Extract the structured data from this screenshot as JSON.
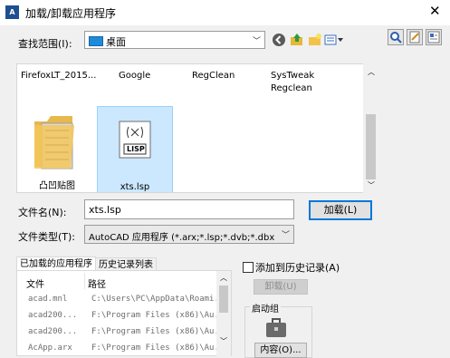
{
  "window": {
    "title": "加载/卸载应用程序",
    "close_glyph": "✕",
    "icon_text": "A"
  },
  "lookin": {
    "label": "查找范围(I):",
    "value": "桌面"
  },
  "files_row1": [
    {
      "name": "FirefoxLT_2015..."
    },
    {
      "name": "Google"
    },
    {
      "name": "RegClean"
    },
    {
      "name": "SysTweak Regclean"
    }
  ],
  "files_row2": [
    {
      "name": "凸凹贴图",
      "icon": "folder-icon"
    },
    {
      "name": "xts.lsp",
      "icon": "lisp-file-icon",
      "badge": "LISP"
    }
  ],
  "filename": {
    "label": "文件名(N):",
    "value": "xts.lsp"
  },
  "filetype": {
    "label": "文件类型(T):",
    "value": "AutoCAD 应用程序 (*.arx;*.lsp;*.dvb;*.dbx;*.vl> "
  },
  "load_button": "加载(L)",
  "tabs": [
    "已加载的应用程序",
    "历史记录列表"
  ],
  "table": {
    "headers": [
      "文件",
      "路径"
    ],
    "rows": [
      [
        "acad.mnl",
        "C:\\Users\\PC\\AppData\\Roami..."
      ],
      [
        "acad200...",
        "F:\\Program Files (x86)\\Au..."
      ],
      [
        "acad200...",
        "F:\\Program Files (x86)\\Au..."
      ],
      [
        "AcApp.arx",
        "F:\\Program Files (x86)\\Au..."
      ]
    ]
  },
  "history_checkbox": "添加到历史记录(A)",
  "unload_button": "卸载(U)",
  "startup": {
    "group_label": "启动组",
    "contents_button": "内容(O)..."
  }
}
